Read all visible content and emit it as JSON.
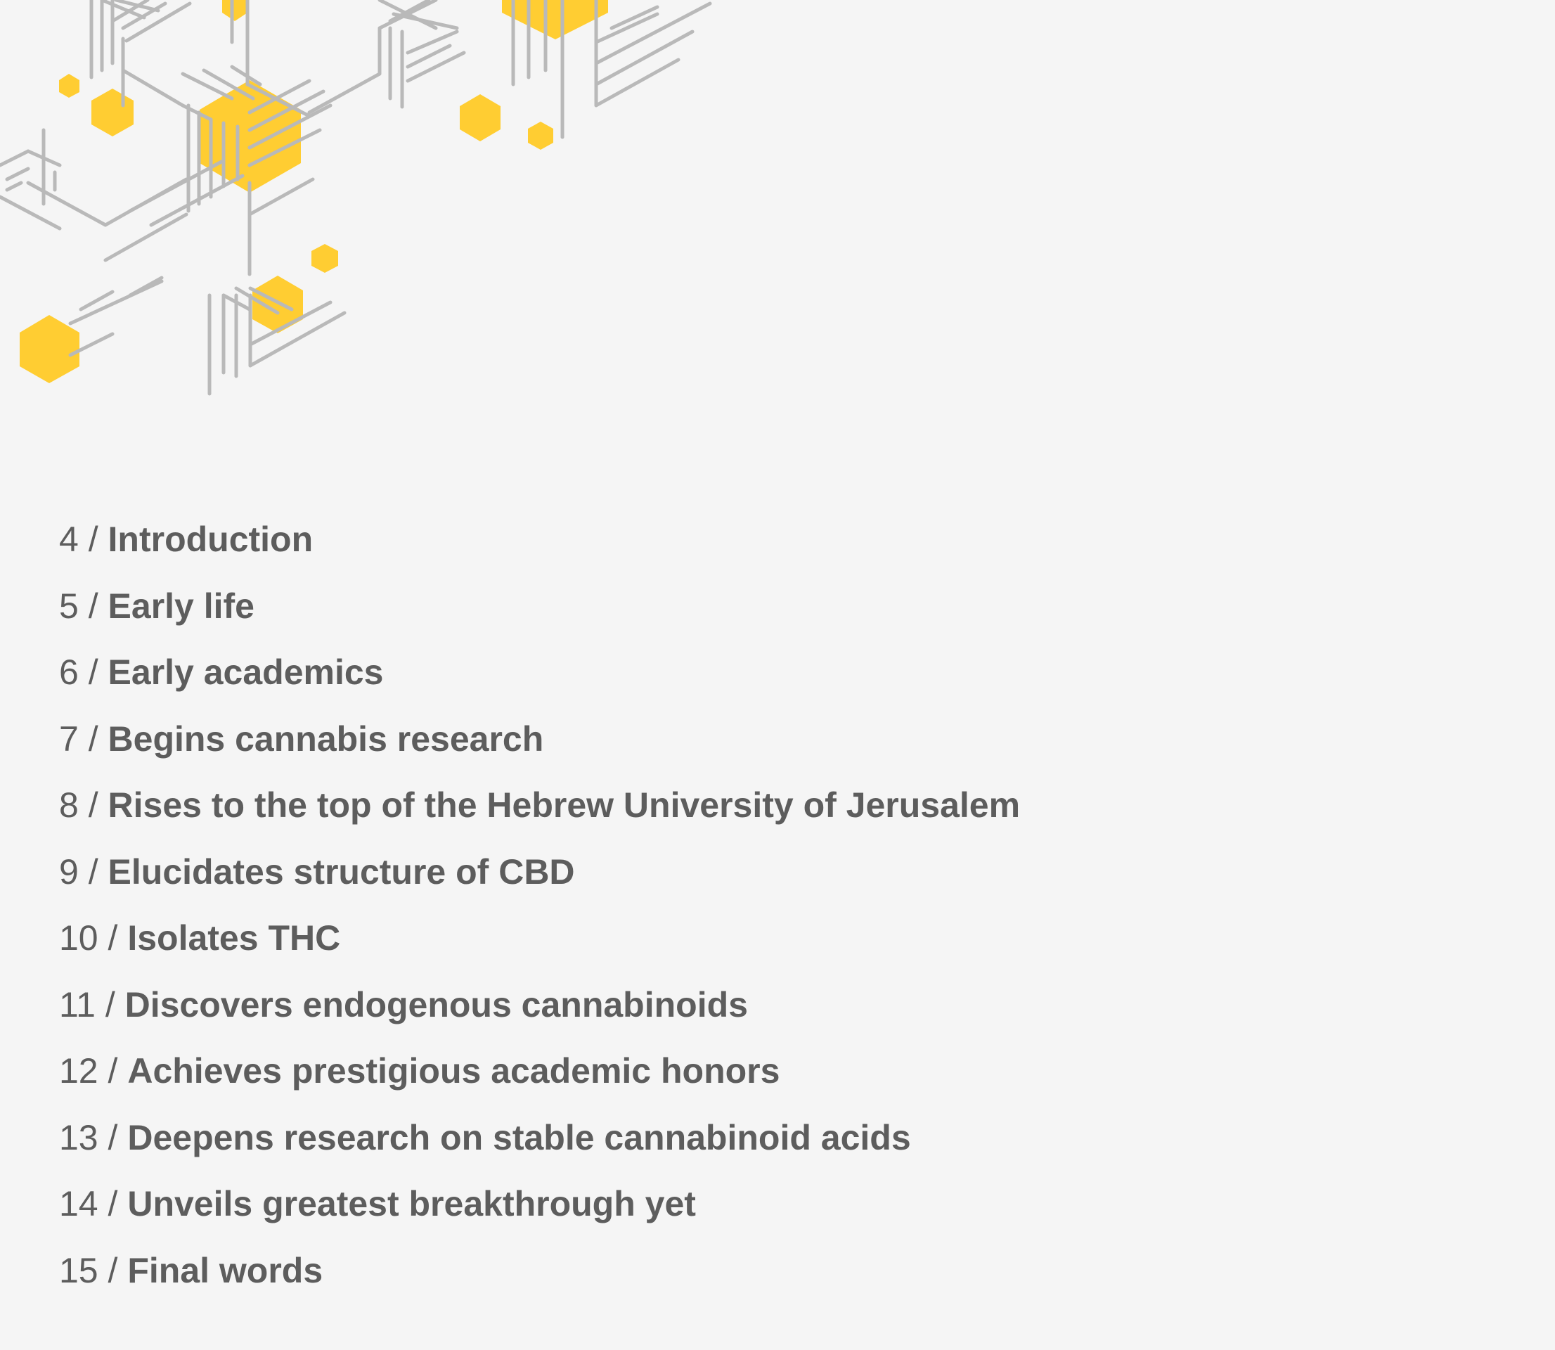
{
  "illustration": {
    "icon": "hexagon-circuit-pattern",
    "colors": {
      "hexagon": "#ffcd32",
      "lines": "#b9b9b9"
    }
  },
  "toc": {
    "separator": "/",
    "items": [
      {
        "page": "4",
        "title": "Introduction"
      },
      {
        "page": "5",
        "title": "Early life"
      },
      {
        "page": "6",
        "title": "Early academics"
      },
      {
        "page": "7",
        "title": "Begins cannabis research"
      },
      {
        "page": "8",
        "title": "Rises to the top of the Hebrew University of Jerusalem"
      },
      {
        "page": "9",
        "title": "Elucidates structure of CBD"
      },
      {
        "page": "10",
        "title": "Isolates THC"
      },
      {
        "page": "11",
        "title": "Discovers endogenous cannabinoids"
      },
      {
        "page": "12",
        "title": "Achieves prestigious academic honors"
      },
      {
        "page": "13",
        "title": "Deepens research on stable cannabinoid acids"
      },
      {
        "page": "14",
        "title": "Unveils greatest breakthrough yet"
      },
      {
        "page": "15",
        "title": "Final words"
      }
    ]
  }
}
